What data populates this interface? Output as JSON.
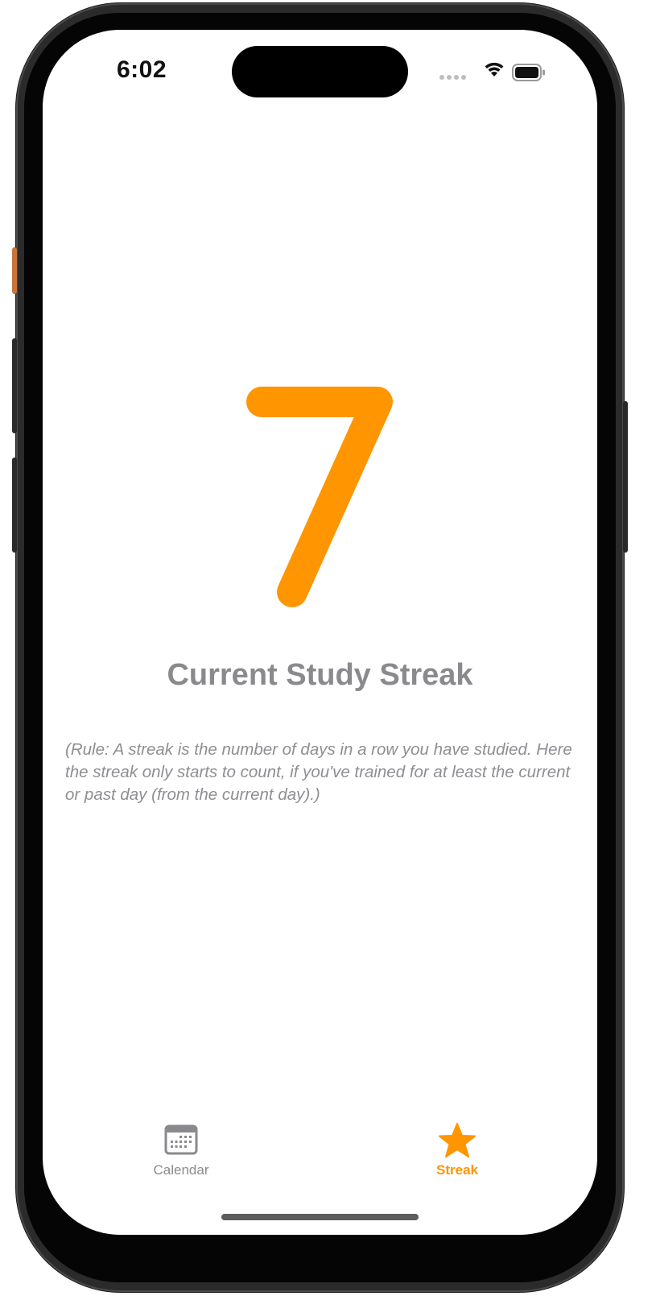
{
  "status_bar": {
    "time": "6:02"
  },
  "streak": {
    "value": "7",
    "title": "Current Study Streak",
    "rule": "(Rule: A streak is the number of days in a row you have studied. Here the streak only starts to count, if you've trained for at least the current or past day (from the current day).)"
  },
  "tab_bar": {
    "tabs": [
      {
        "label": "Calendar",
        "icon": "calendar-icon",
        "selected": false
      },
      {
        "label": "Streak",
        "icon": "star-icon",
        "selected": true
      }
    ]
  },
  "colors": {
    "accent": "#ff9500",
    "secondary_text": "#8a8a8e",
    "background": "#ffffff"
  }
}
